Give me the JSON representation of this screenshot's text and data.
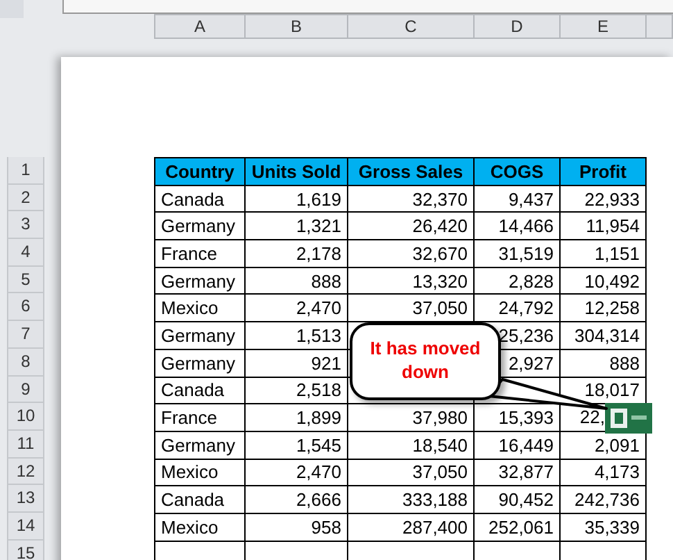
{
  "column_headers": [
    "A",
    "B",
    "C",
    "D",
    "E"
  ],
  "row_numbers": [
    "1",
    "2",
    "3",
    "4",
    "5",
    "6",
    "7",
    "8",
    "9",
    "10",
    "11",
    "12",
    "13",
    "14",
    "15"
  ],
  "table": {
    "columns": [
      "Country",
      "Units Sold",
      "Gross Sales",
      "COGS",
      "Profit"
    ],
    "rows": [
      [
        "Canada",
        "1,619",
        "32,370",
        "9,437",
        "22,933"
      ],
      [
        "Germany",
        "1,321",
        "26,420",
        "14,466",
        "11,954"
      ],
      [
        "France",
        "2,178",
        "32,670",
        "31,519",
        "1,151"
      ],
      [
        "Germany",
        "888",
        "13,320",
        "2,828",
        "10,492"
      ],
      [
        "Mexico",
        "2,470",
        "37,050",
        "24,792",
        "12,258"
      ],
      [
        "Germany",
        "1,513",
        null,
        "25,236",
        "304,314"
      ],
      [
        "Germany",
        "921",
        null,
        "2,927",
        "888"
      ],
      [
        "Canada",
        "2,518",
        null,
        null,
        "18,017"
      ],
      [
        "France",
        "1,899",
        "37,980",
        "15,393",
        {
          "text": "22,",
          "kind": "under-icon"
        }
      ],
      [
        "Germany",
        "1,545",
        "18,540",
        "16,449",
        "2,091"
      ],
      [
        "Mexico",
        "2,470",
        "37,050",
        "32,877",
        "4,173"
      ],
      [
        "Canada",
        "2,666",
        "333,188",
        "90,452",
        "242,736"
      ],
      [
        "Mexico",
        "958",
        "287,400",
        "252,061",
        "35,339"
      ]
    ]
  },
  "callout": {
    "text": "It has moved down"
  }
}
